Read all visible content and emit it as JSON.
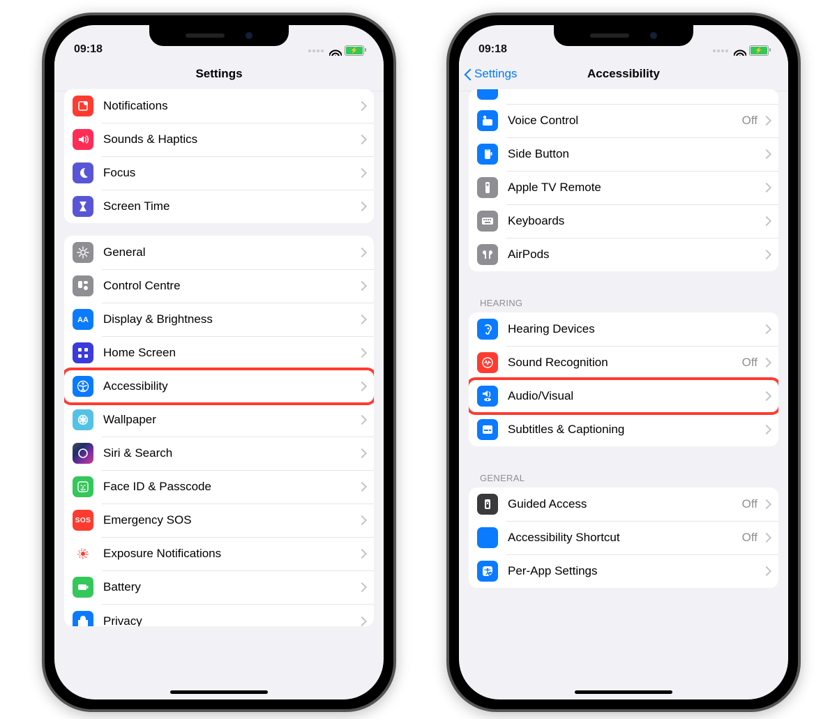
{
  "status": {
    "time": "09:18"
  },
  "screens": {
    "settings": {
      "title": "Settings",
      "group1": [
        {
          "id": "notifications",
          "label": "Notifications",
          "color": "#ff3b30"
        },
        {
          "id": "sounds",
          "label": "Sounds & Haptics",
          "color": "#ff2d55"
        },
        {
          "id": "focus",
          "label": "Focus",
          "color": "#5856d6"
        },
        {
          "id": "screen-time",
          "label": "Screen Time",
          "color": "#5856d6"
        }
      ],
      "group2": [
        {
          "id": "general",
          "label": "General",
          "color": "#8e8e93"
        },
        {
          "id": "control-centre",
          "label": "Control Centre",
          "color": "#8e8e93"
        },
        {
          "id": "display",
          "label": "Display & Brightness",
          "color": "#0a7aff"
        },
        {
          "id": "home-screen",
          "label": "Home Screen",
          "color": "#3a3add"
        },
        {
          "id": "accessibility",
          "label": "Accessibility",
          "color": "#0a7aff",
          "highlight": true
        },
        {
          "id": "wallpaper",
          "label": "Wallpaper",
          "color": "#54c1e6"
        },
        {
          "id": "siri",
          "label": "Siri & Search",
          "color": "grad"
        },
        {
          "id": "faceid",
          "label": "Face ID & Passcode",
          "color": "#34c759"
        },
        {
          "id": "sos",
          "label": "Emergency SOS",
          "color": "#ff3b30",
          "sos": true
        },
        {
          "id": "exposure",
          "label": "Exposure Notifications",
          "color": "#ffffff",
          "redglyph": true
        },
        {
          "id": "battery",
          "label": "Battery",
          "color": "#34c759"
        },
        {
          "id": "privacy",
          "label": "Privacy",
          "color": "#0a7aff"
        }
      ]
    },
    "accessibility": {
      "back": "Settings",
      "title": "Accessibility",
      "group0": [
        {
          "id": "voice-control",
          "label": "Voice Control",
          "color": "#0a7aff",
          "value": "Off"
        },
        {
          "id": "side-button",
          "label": "Side Button",
          "color": "#0a7aff"
        },
        {
          "id": "tv-remote",
          "label": "Apple TV Remote",
          "color": "#8e8e93"
        },
        {
          "id": "keyboards",
          "label": "Keyboards",
          "color": "#8e8e93"
        },
        {
          "id": "airpods",
          "label": "AirPods",
          "color": "#8e8e93"
        }
      ],
      "hearing_header": "Hearing",
      "group1": [
        {
          "id": "hearing-dev",
          "label": "Hearing Devices",
          "color": "#0a7aff"
        },
        {
          "id": "sound-recog",
          "label": "Sound Recognition",
          "color": "#ff3b30",
          "value": "Off"
        },
        {
          "id": "audio-visual",
          "label": "Audio/Visual",
          "color": "#0a7aff",
          "highlight": true
        },
        {
          "id": "subtitles",
          "label": "Subtitles & Captioning",
          "color": "#0a7aff"
        }
      ],
      "general_header": "General",
      "group2": [
        {
          "id": "guided",
          "label": "Guided Access",
          "color": "#3a3a3c",
          "value": "Off"
        },
        {
          "id": "shortcut",
          "label": "Accessibility Shortcut",
          "color": "#0a7aff",
          "value": "Off"
        },
        {
          "id": "per-app",
          "label": "Per-App Settings",
          "color": "#0a7aff"
        }
      ]
    }
  }
}
